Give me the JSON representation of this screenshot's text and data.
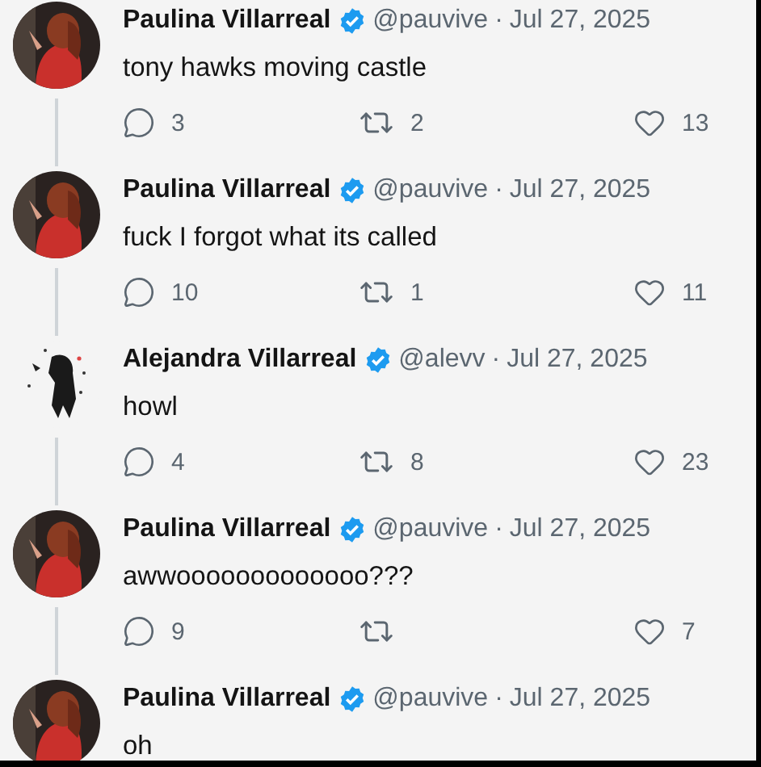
{
  "tweets": [
    {
      "name": "Paulina Villarreal",
      "verified": true,
      "handle": "@pauvive",
      "dot": "·",
      "date": "Jul 27, 2025",
      "text": "tony hawks moving castle",
      "replies": "3",
      "retweets": "2",
      "likes": "13"
    },
    {
      "name": "Paulina Villarreal",
      "verified": true,
      "handle": "@pauvive",
      "dot": "·",
      "date": "Jul 27, 2025",
      "text": "fuck I forgot what its called",
      "replies": "10",
      "retweets": "1",
      "likes": "11"
    },
    {
      "name": "Alejandra Villarreal",
      "verified": true,
      "handle": "@alevv",
      "dot": "·",
      "date": "Jul 27, 2025",
      "text": "howl",
      "replies": "4",
      "retweets": "8",
      "likes": "23"
    },
    {
      "name": "Paulina Villarreal",
      "verified": true,
      "handle": "@pauvive",
      "dot": "·",
      "date": "Jul 27, 2025",
      "text": "awwooooooooooooo???",
      "replies": "9",
      "likes": "7"
    },
    {
      "name": "Paulina Villarreal",
      "verified": true,
      "handle": "@pauvive",
      "dot": "·",
      "date": "Jul 27, 2025",
      "text": "oh"
    }
  ]
}
